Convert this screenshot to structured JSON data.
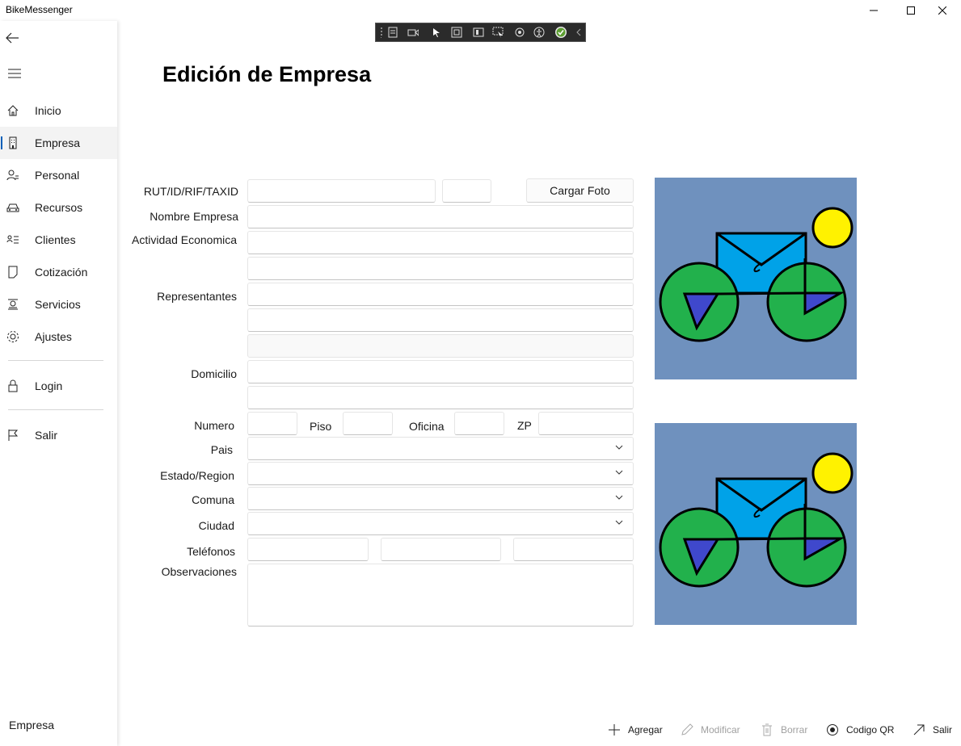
{
  "window": {
    "title": "BikeMessenger"
  },
  "sidebar": {
    "items": [
      {
        "label": "Inicio",
        "icon": "home-icon"
      },
      {
        "label": "Empresa",
        "icon": "building-icon",
        "selected": true
      },
      {
        "label": "Personal",
        "icon": "person-swap-icon"
      },
      {
        "label": "Recursos",
        "icon": "vehicle-icon"
      },
      {
        "label": "Clientes",
        "icon": "contact-list-icon"
      },
      {
        "label": "Cotización",
        "icon": "document-icon"
      },
      {
        "label": "Servicios",
        "icon": "service-icon"
      },
      {
        "label": "Ajustes",
        "icon": "gear-icon"
      }
    ],
    "bottom_items": [
      {
        "label": "Login",
        "icon": "lock-icon"
      },
      {
        "label": "Salir",
        "icon": "flag-icon"
      }
    ],
    "footer": "Empresa"
  },
  "page": {
    "title": "Edición de Empresa",
    "labels": {
      "rut": "RUT/ID/RIF/TAXID",
      "nombre": "Nombre Empresa",
      "actividad": "Actividad Economica",
      "representantes": "Representantes",
      "domicilio": "Domicilio",
      "numero": "Numero",
      "piso": "Piso",
      "oficina": "Oficina",
      "zp": "ZP",
      "pais": "Pais",
      "estado": "Estado/Region",
      "comuna": "Comuna",
      "ciudad": "Ciudad",
      "telefonos": "Teléfonos",
      "observaciones": "Observaciones"
    },
    "cargar_foto": "Cargar Foto",
    "fields": {
      "rut": "",
      "rut_dv": "",
      "nombre": "",
      "actividad_1": "",
      "actividad_2": "",
      "representantes_1": "",
      "representantes_2": "",
      "representantes_3": "",
      "domicilio_1": "",
      "domicilio_2": "",
      "numero": "",
      "piso": "",
      "oficina": "",
      "zp": "",
      "pais": "",
      "estado": "",
      "comuna": "",
      "ciudad": "",
      "telefono_1": "",
      "telefono_2": "",
      "telefono_3": "",
      "observaciones": ""
    }
  },
  "commands": [
    {
      "label": "Agregar",
      "icon": "plus-icon",
      "enabled": true
    },
    {
      "label": "Modificar",
      "icon": "pencil-icon",
      "enabled": false
    },
    {
      "label": "Borrar",
      "icon": "trash-icon",
      "enabled": false
    },
    {
      "label": "Codigo QR",
      "icon": "radio-dot-icon",
      "enabled": true
    },
    {
      "label": "Salir",
      "icon": "arrow-up-right-icon",
      "enabled": true
    }
  ],
  "colors": {
    "image_bg": "#6f91be",
    "wheel": "#22b14c",
    "envelope": "#00a2e8",
    "sun": "#fff200",
    "triangle": "#3f48cc",
    "accent": "#005fb8"
  }
}
